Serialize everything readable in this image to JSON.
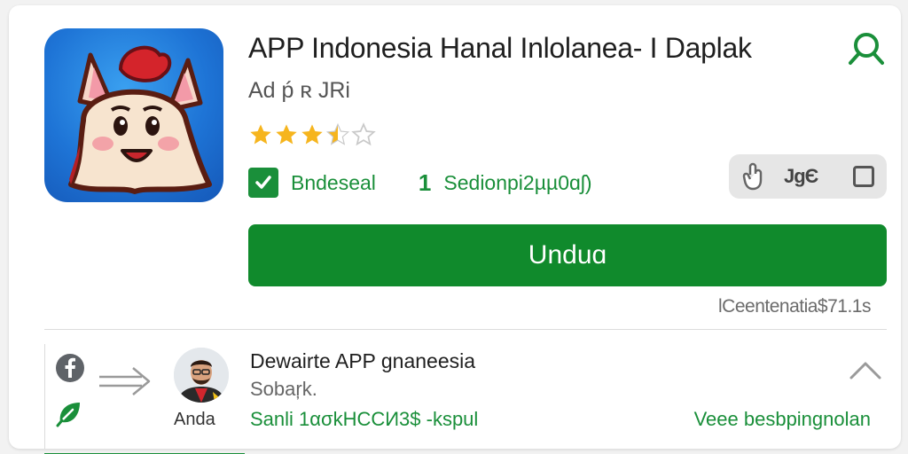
{
  "app": {
    "title": "APP Indonesia Hanal Inlolanea- I Daplak",
    "developer": "Ad ṕ ʀ JRi",
    "rating_value": 3.5,
    "rating_max": 5,
    "badge_label": "Bndeseal",
    "downloads_num": "1",
    "downloads_label": "Sedionpi2µµ0ɑʃ)",
    "pill_count": "JɡЄ",
    "install_label": "Unduɑ",
    "size_info": "lCeentenatia$71.1s"
  },
  "review": {
    "avatar_label": "Anda",
    "title": "Dewairte APP gnaneesia",
    "subtitle": "Sobaŗk.",
    "meta": "Sanli 1ασkHССИ3$ -kspul",
    "see_more_label": "Veee besbpingnolan"
  },
  "colors": {
    "accent_green": "#108a2c",
    "text_green": "#1a8f3a",
    "star_gold": "#f6b51e",
    "icon_blue": "#1e74d6"
  },
  "icons": [
    "search-icon",
    "star-icon",
    "check-icon",
    "hand-icon",
    "checkbox-icon",
    "facebook-icon",
    "leaf-icon",
    "arrows-icon",
    "chevron-up-icon"
  ]
}
